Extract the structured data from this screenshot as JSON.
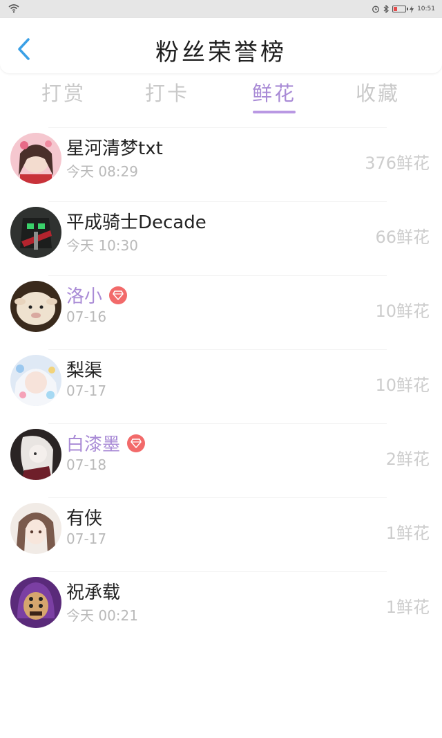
{
  "status_bar": {
    "time": "10:51",
    "icons": [
      "wifi-icon",
      "alarm-icon",
      "bluetooth-icon",
      "battery-icon",
      "charging-icon"
    ]
  },
  "header": {
    "title": "粉丝荣誉榜",
    "back_icon": "chevron-left-icon"
  },
  "tabs": [
    {
      "label": "打赏",
      "active": false
    },
    {
      "label": "打卡",
      "active": false
    },
    {
      "label": "鲜花",
      "active": true
    },
    {
      "label": "收藏",
      "active": false
    }
  ],
  "fans": [
    {
      "name": "星河清梦txt",
      "time": "今天 08:29",
      "count": "376鲜花",
      "vip": false
    },
    {
      "name": "平成骑士Decade",
      "time": "今天 10:30",
      "count": "66鲜花",
      "vip": false
    },
    {
      "name": "洛小",
      "time": "07-16",
      "count": "10鲜花",
      "vip": true
    },
    {
      "name": "梨渠",
      "time": "07-17",
      "count": "10鲜花",
      "vip": false
    },
    {
      "name": "白漆墨",
      "time": "07-18",
      "count": "2鲜花",
      "vip": true
    },
    {
      "name": "有侠",
      "time": "07-17",
      "count": "1鲜花",
      "vip": false
    },
    {
      "name": "祝承载",
      "time": "今天 00:21",
      "count": "1鲜花",
      "vip": false
    }
  ],
  "colors": {
    "accent": "#a98bd6",
    "back": "#3aa0e6",
    "badge": "#f26a6a",
    "muted": "#c9c9c9"
  }
}
